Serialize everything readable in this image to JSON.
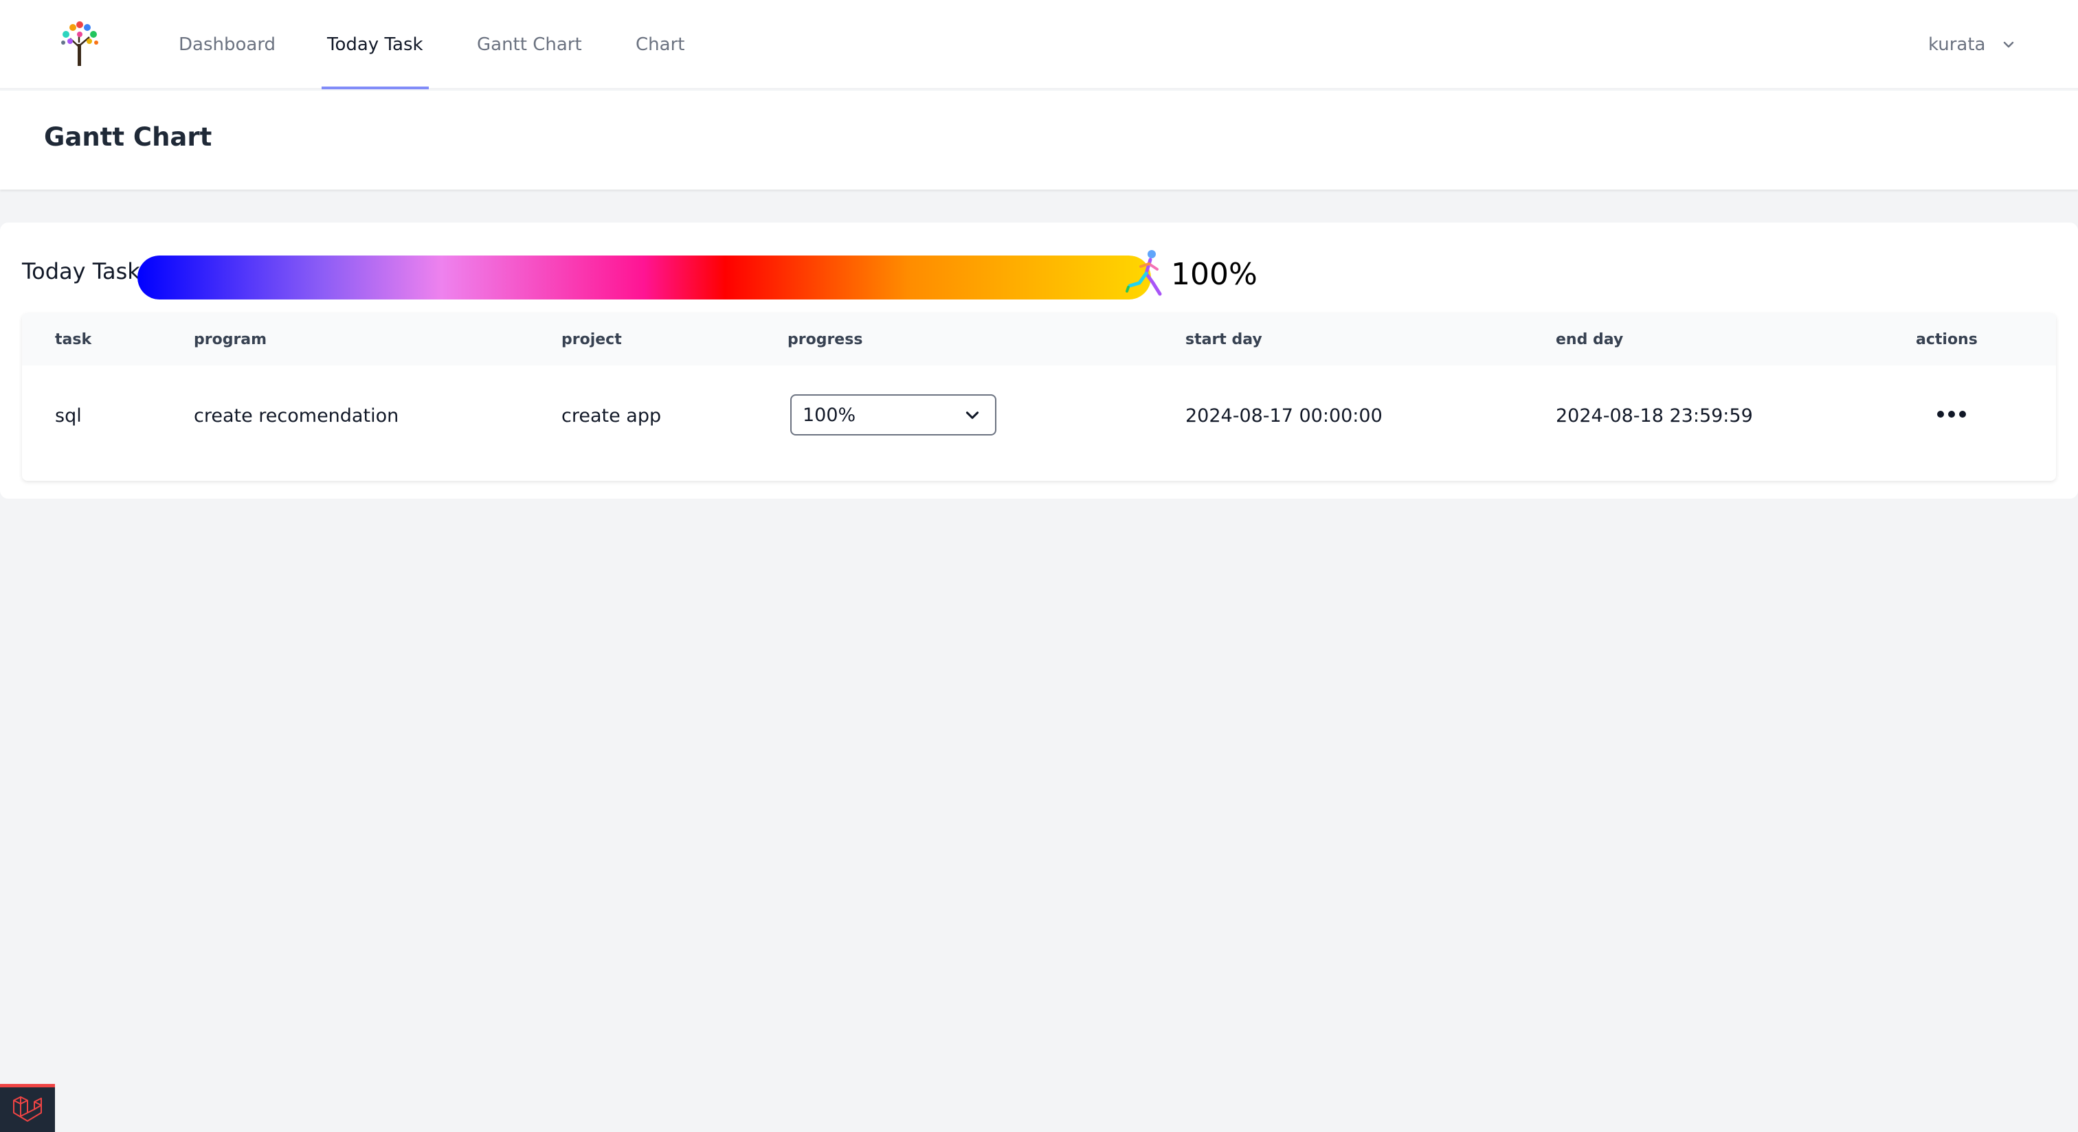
{
  "nav": {
    "items": [
      {
        "label": "Dashboard"
      },
      {
        "label": "Today Task",
        "active": true
      },
      {
        "label": "Gantt Chart"
      },
      {
        "label": "Chart"
      }
    ],
    "user": "kurata"
  },
  "header": {
    "title": "Gantt Chart"
  },
  "today": {
    "label": "Today Task",
    "progress_percent": 100,
    "progress_text": "100%"
  },
  "table": {
    "columns": [
      "task",
      "program",
      "project",
      "progress",
      "start day",
      "end day",
      "actions"
    ],
    "rows": [
      {
        "task": "sql",
        "program": "create recomendation",
        "project": "create app",
        "progress": "100%",
        "start_day": "2024-08-17 00:00:00",
        "end_day": "2024-08-18 23:59:59"
      }
    ]
  },
  "colors": {
    "accent": "#818cf8",
    "badge_bg": "#1f2937",
    "badge_accent": "#ef4444"
  },
  "icons": {
    "logo": "tree-logo-icon",
    "user_menu": "chevron-down-icon",
    "select": "chevron-down-icon",
    "runner": "runner-icon",
    "actions": "more-horizontal-icon",
    "badge": "laravel-icon"
  }
}
